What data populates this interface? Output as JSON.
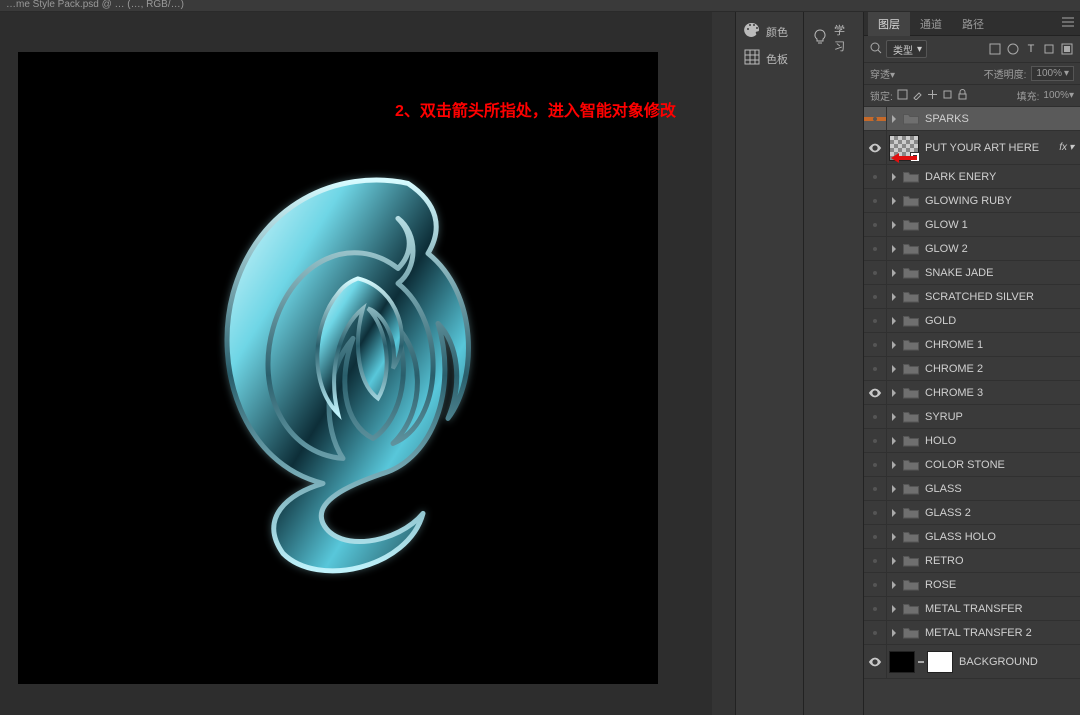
{
  "top_title_fragment": "…me Style Pack.psd @ … (…, RGB/…)",
  "narrow_panels": [
    {
      "icon": "palette",
      "label": "颜色"
    },
    {
      "icon": "bulb",
      "label": "学习"
    },
    {
      "icon": "swatch",
      "label": "色板"
    }
  ],
  "tabs": {
    "layers": "图层",
    "channels": "通道",
    "paths": "路径"
  },
  "filter": {
    "label": "类型"
  },
  "blend": {
    "mode": "穿透",
    "opacity_label": "不透明度:",
    "opacity_value": "100%"
  },
  "locks": {
    "label": "锁定:",
    "fill_label": "填充:",
    "fill_value": "100%"
  },
  "annotation_text": "2、双击箭头所指处，进入智能对象修改",
  "fx_label": "fx",
  "layers_list": [
    {
      "kind": "folder",
      "name": "SPARKS",
      "visible": false,
      "selected": true,
      "highlight_eye": true
    },
    {
      "kind": "smart",
      "name": "PUT YOUR ART HERE",
      "visible": true,
      "fx": true,
      "tall": true,
      "arrow": true
    },
    {
      "kind": "folder",
      "name": "DARK ENERY",
      "visible": false
    },
    {
      "kind": "folder",
      "name": "GLOWING RUBY",
      "visible": false
    },
    {
      "kind": "folder",
      "name": "GLOW 1",
      "visible": false
    },
    {
      "kind": "folder",
      "name": "GLOW 2",
      "visible": false
    },
    {
      "kind": "folder",
      "name": "SNAKE JADE",
      "visible": false
    },
    {
      "kind": "folder",
      "name": "SCRATCHED SILVER",
      "visible": false
    },
    {
      "kind": "folder",
      "name": "GOLD",
      "visible": false
    },
    {
      "kind": "folder",
      "name": "CHROME 1",
      "visible": false
    },
    {
      "kind": "folder",
      "name": "CHROME 2",
      "visible": false
    },
    {
      "kind": "folder",
      "name": "CHROME 3",
      "visible": true
    },
    {
      "kind": "folder",
      "name": "SYRUP",
      "visible": false
    },
    {
      "kind": "folder",
      "name": "HOLO",
      "visible": false
    },
    {
      "kind": "folder",
      "name": "COLOR STONE",
      "visible": false
    },
    {
      "kind": "folder",
      "name": "GLASS",
      "visible": false
    },
    {
      "kind": "folder",
      "name": "GLASS 2",
      "visible": false
    },
    {
      "kind": "folder",
      "name": "GLASS HOLO",
      "visible": false
    },
    {
      "kind": "folder",
      "name": "RETRO",
      "visible": false
    },
    {
      "kind": "folder",
      "name": "ROSE",
      "visible": false
    },
    {
      "kind": "folder",
      "name": "METAL TRANSFER",
      "visible": false
    },
    {
      "kind": "folder",
      "name": "METAL TRANSFER 2",
      "visible": false
    },
    {
      "kind": "bg",
      "name": "BACKGROUND",
      "visible": true,
      "tall": true
    }
  ]
}
